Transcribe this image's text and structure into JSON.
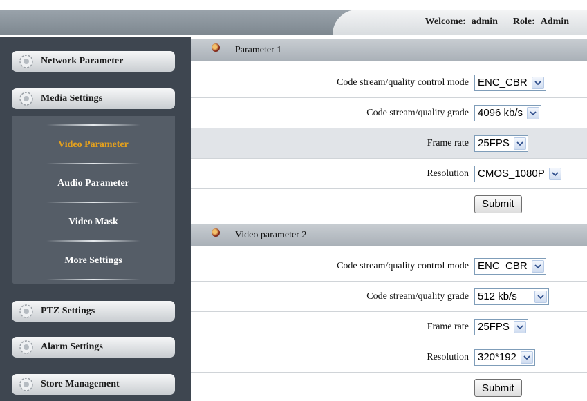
{
  "header": {
    "welcome_label": "Welcome:",
    "user": "admin",
    "role_label": "Role:",
    "role": "Admin"
  },
  "sidebar": {
    "items": [
      {
        "label": "Network Parameter",
        "icon": "gear-icon"
      },
      {
        "label": "Media Settings",
        "icon": "gear-icon"
      },
      {
        "label": "PTZ Settings",
        "icon": "gear-icon"
      },
      {
        "label": "Alarm Settings",
        "icon": "gear-icon"
      },
      {
        "label": "Store Management",
        "icon": "gear-icon"
      }
    ],
    "submenu": [
      {
        "label": "Video Parameter",
        "active": true
      },
      {
        "label": "Audio Parameter",
        "active": false
      },
      {
        "label": "Video Mask",
        "active": false
      },
      {
        "label": "More Settings",
        "active": false
      }
    ],
    "active_color": "#e3a01e"
  },
  "sections": [
    {
      "title": "Parameter 1",
      "fields": [
        {
          "label": "Code stream/quality control mode",
          "value": "ENC_CBR"
        },
        {
          "label": "Code stream/quality grade",
          "value": "4096 kb/s"
        },
        {
          "label": "Frame rate",
          "value": "25FPS"
        },
        {
          "label": "Resolution",
          "value": "CMOS_1080P"
        }
      ],
      "submit_label": "Submit"
    },
    {
      "title": "Video parameter 2",
      "fields": [
        {
          "label": "Code stream/quality control mode",
          "value": "ENC_CBR"
        },
        {
          "label": "Code stream/quality grade",
          "value": "512 kb/s"
        },
        {
          "label": "Frame rate",
          "value": "25FPS"
        },
        {
          "label": "Resolution",
          "value": "320*192"
        }
      ],
      "submit_label": "Submit"
    }
  ]
}
